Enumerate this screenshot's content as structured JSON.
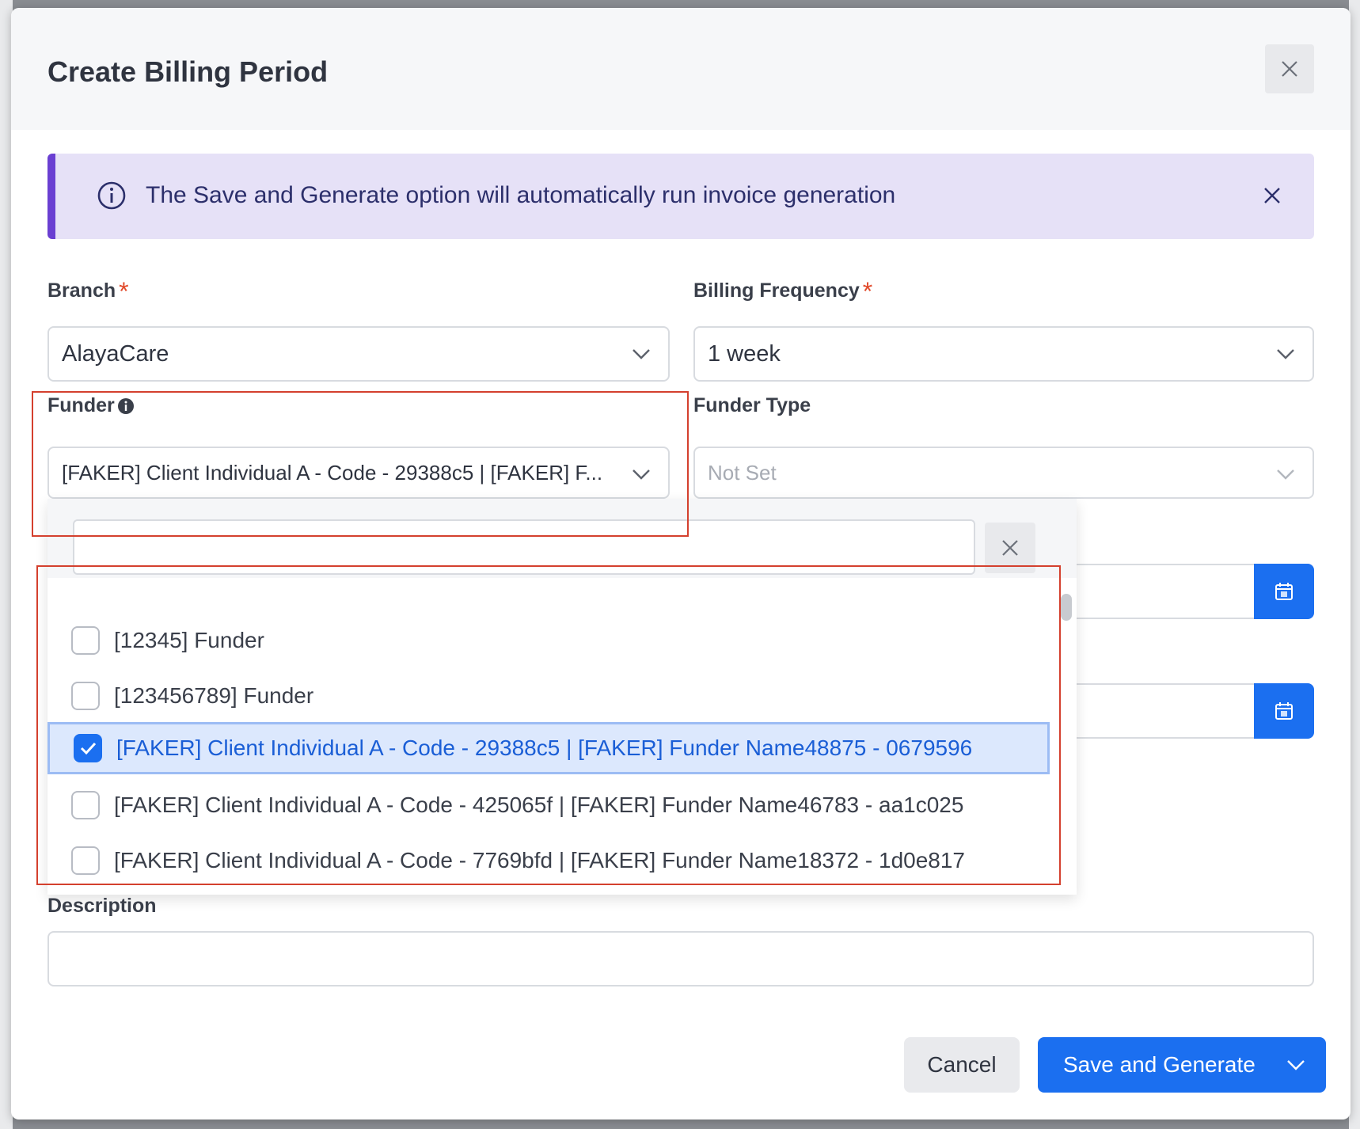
{
  "modal": {
    "title": "Create Billing Period"
  },
  "banner": {
    "text": "The Save and Generate option will automatically run invoice generation"
  },
  "fields": {
    "branch": {
      "label": "Branch",
      "required_mark": "*",
      "value": "AlayaCare"
    },
    "billing_frequency": {
      "label": "Billing Frequency",
      "required_mark": "*",
      "value": "1 week"
    },
    "funder": {
      "label": "Funder",
      "value": "[FAKER] Client Individual A - Code - 29388c5 | [FAKER] F..."
    },
    "funder_type": {
      "label": "Funder Type",
      "value": "Not Set"
    },
    "description": {
      "label": "Description",
      "value": ""
    }
  },
  "dropdown": {
    "search_value": "",
    "items": [
      {
        "label": "[12345] Funder",
        "checked": false
      },
      {
        "label": "[123456789] Funder",
        "checked": false
      },
      {
        "label": "[FAKER] Client Individual A - Code - 29388c5 | [FAKER] Funder Name48875 - 0679596",
        "checked": true
      },
      {
        "label": "[FAKER] Client Individual A - Code - 425065f | [FAKER] Funder Name46783 - aa1c025",
        "checked": false
      },
      {
        "label": "[FAKER] Client Individual A - Code - 7769bfd | [FAKER] Funder Name18372 - 1d0e817",
        "checked": false
      }
    ]
  },
  "footer": {
    "cancel_label": "Cancel",
    "save_label": "Save and Generate"
  },
  "colors": {
    "primary": "#1b6ff0",
    "banner_bg": "#e6e1f7",
    "banner_accent": "#6a3fd2",
    "required": "#e14a2b",
    "highlight_box": "#d4402e"
  }
}
